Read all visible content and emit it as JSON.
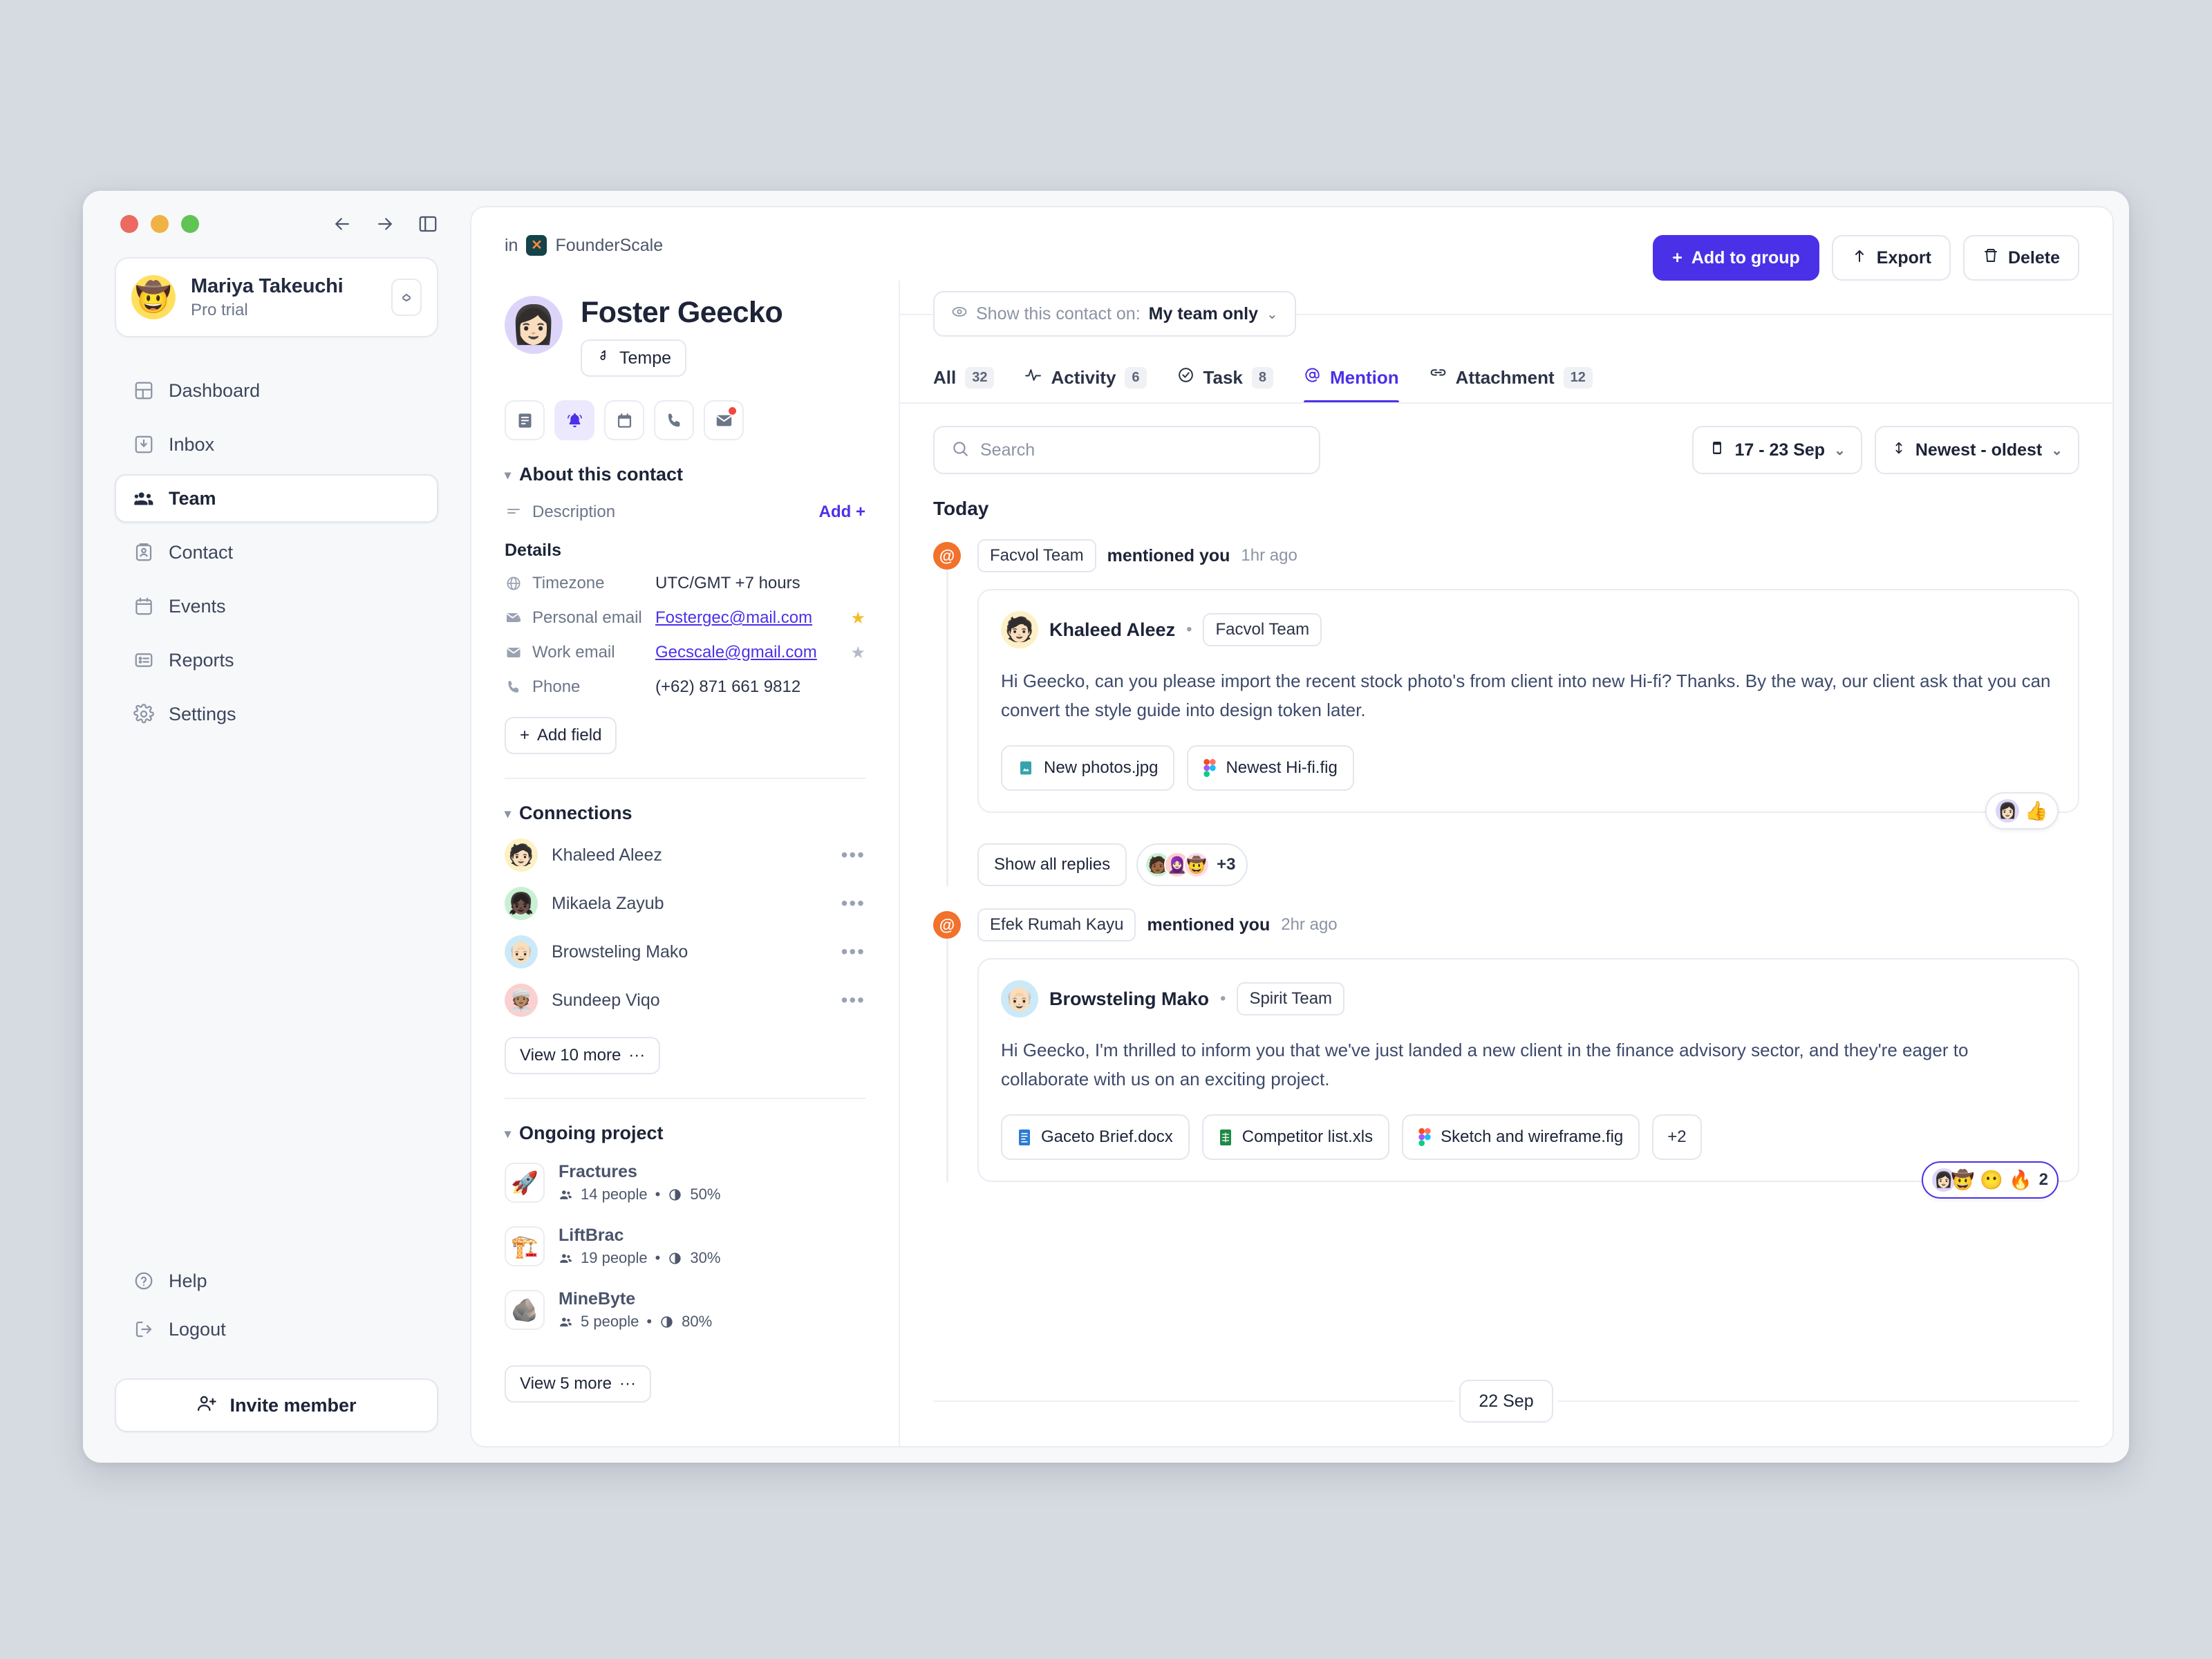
{
  "window": {
    "nav_back": "back-arrow",
    "nav_forward": "forward-arrow",
    "panel_toggle": "sidebar-toggle"
  },
  "sidebar": {
    "profile": {
      "name": "Mariya Takeuchi",
      "plan": "Pro trial",
      "avatar_emoji": "🤠"
    },
    "items": [
      {
        "label": "Dashboard",
        "icon": "dashboard-icon",
        "active": false
      },
      {
        "label": "Inbox",
        "icon": "inbox-icon",
        "active": false
      },
      {
        "label": "Team",
        "icon": "team-icon",
        "active": true
      },
      {
        "label": "Contact",
        "icon": "contact-icon",
        "active": false
      },
      {
        "label": "Events",
        "icon": "calendar-icon",
        "active": false
      },
      {
        "label": "Reports",
        "icon": "reports-icon",
        "active": false
      },
      {
        "label": "Settings",
        "icon": "gear-icon",
        "active": false
      }
    ],
    "help_label": "Help",
    "logout_label": "Logout",
    "invite_label": "Invite member"
  },
  "header": {
    "breadcrumb_prefix": "in",
    "workspace": "FounderScale",
    "actions": {
      "add_to_group": "Add to group",
      "export": "Export",
      "delete": "Delete"
    }
  },
  "contact": {
    "name": "Foster Geecko",
    "avatar_emoji": "👩🏻",
    "tag": "Tempe",
    "quick_icons": [
      "note-icon",
      "bell-icon",
      "calendar-icon",
      "phone-icon",
      "mail-icon"
    ],
    "about": {
      "title": "About this contact",
      "description_label": "Description",
      "description_add": "Add +",
      "details_label": "Details",
      "fields": [
        {
          "label": "Timezone",
          "value": "UTC/GMT +7 hours",
          "icon": "globe-icon",
          "link": false,
          "star": "none"
        },
        {
          "label": "Personal email",
          "value": "Fostergec@mail.com",
          "icon": "mail-lock-icon",
          "link": true,
          "star": "on"
        },
        {
          "label": "Work email",
          "value": "Gecscale@gmail.com",
          "icon": "mail-icon",
          "link": true,
          "star": "off"
        },
        {
          "label": "Phone",
          "value": "(+62) 871 661 9812",
          "icon": "phone-icon",
          "link": false,
          "star": "none"
        }
      ],
      "add_field_label": "Add field"
    },
    "connections": {
      "title": "Connections",
      "people": [
        {
          "name": "Khaleed Aleez",
          "emoji": "🧑🏻",
          "bg": "#fdf0c4"
        },
        {
          "name": "Mikaela Zayub",
          "emoji": "👧🏿",
          "bg": "#c9f0d3"
        },
        {
          "name": "Browsteling Mako",
          "emoji": "👴🏻",
          "bg": "#cce9f8"
        },
        {
          "name": "Sundeep Viqo",
          "emoji": "👳🏽",
          "bg": "#fbd0d0"
        }
      ],
      "view_more": "View 10 more"
    },
    "projects": {
      "title": "Ongoing project",
      "items": [
        {
          "name": "Fractures",
          "emoji": "🚀",
          "people": "14 people",
          "progress": "50%"
        },
        {
          "name": "LiftBrac",
          "emoji": "🏗️",
          "people": "19 people",
          "progress": "30%"
        },
        {
          "name": "MineByte",
          "emoji": "🪨",
          "people": "5 people",
          "progress": "80%"
        }
      ],
      "view_more": "View 5 more"
    }
  },
  "feed": {
    "visibility": {
      "prefix": "Show this contact on:",
      "value": "My team only"
    },
    "tabs": [
      {
        "label": "All",
        "count": "32",
        "icon": "",
        "active": false
      },
      {
        "label": "Activity",
        "count": "6",
        "icon": "pulse-icon",
        "active": false
      },
      {
        "label": "Task",
        "count": "8",
        "icon": "check-circle-icon",
        "active": false
      },
      {
        "label": "Mention",
        "count": "",
        "icon": "at-icon",
        "active": true
      },
      {
        "label": "Attachment",
        "count": "12",
        "icon": "link-icon",
        "active": false
      }
    ],
    "search_placeholder": "Search",
    "search_value": "",
    "date_range": "17 - 23 Sep",
    "sort": "Newest - oldest",
    "day_label": "Today",
    "mentions": [
      {
        "source_team": "Facvol Team",
        "action": "mentioned you",
        "time": "1hr ago",
        "author": "Khaleed Aleez",
        "author_emoji": "🧑🏻",
        "author_bg": "#fdf0c4",
        "author_team": "Facvol Team",
        "message": "Hi Geecko, can you please import the recent stock photo's from client into new Hi-fi? Thanks. By the way, our client ask that you can convert the style guide into design token later.",
        "attachments": [
          {
            "name": "New photos.jpg",
            "icon": "image-file-icon"
          },
          {
            "name": "Newest Hi-fi.fig",
            "icon": "figma-file-icon"
          }
        ],
        "reaction": {
          "avatar_emoji": "👩🏻",
          "avatar_bg": "#ddd5f9",
          "emoji": "👍",
          "count": "",
          "accent": false
        },
        "replies_label": "Show all replies",
        "repliers": [
          {
            "emoji": "🧑🏾",
            "bg": "#c9f0d3"
          },
          {
            "emoji": "🧕🏻",
            "bg": "#fbd0d0"
          },
          {
            "emoji": "🤠",
            "bg": "#fbd9e6"
          }
        ],
        "repliers_more": "+3"
      },
      {
        "source_team": "Efek Rumah Kayu",
        "action": "mentioned you",
        "time": "2hr ago",
        "author": "Browsteling Mako",
        "author_emoji": "👴🏻",
        "author_bg": "#cce9f8",
        "author_team": "Spirit Team",
        "message": "Hi Geecko, I'm thrilled to inform you that we've just landed a new client in the finance advisory sector, and they're eager to collaborate with us on an exciting project.",
        "attachments": [
          {
            "name": "Gaceto Brief.docx",
            "icon": "word-file-icon"
          },
          {
            "name": "Competitor list.xls",
            "icon": "excel-file-icon"
          },
          {
            "name": "Sketch and wireframe.fig",
            "icon": "figma-file-icon"
          },
          {
            "name": "+2",
            "icon": "more-files-icon"
          }
        ],
        "reaction": {
          "avatar_emoji": "👩🏻",
          "avatar_bg": "#ddd5f9",
          "emoji": "🤠",
          "emoji2": "😶",
          "emoji3": "🔥",
          "count": "2",
          "accent": true
        },
        "replies_label": "",
        "repliers": [],
        "repliers_more": ""
      }
    ],
    "date_divider": "22 Sep"
  }
}
